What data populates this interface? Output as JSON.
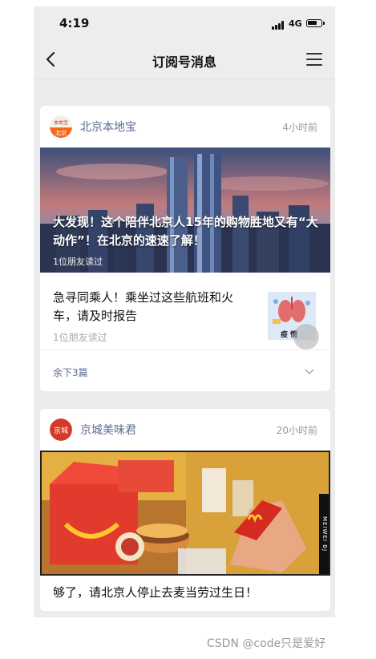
{
  "status": {
    "time": "4:19",
    "network": "4G"
  },
  "nav": {
    "title": "订阅号消息"
  },
  "card1": {
    "source_name": "北京本地宝",
    "time": "4小时前",
    "avatar_text_top": "本地宝",
    "avatar_text_bottom": "北京",
    "hero_title": "大发现！这个陪伴北京人15年的购物胜地又有“大动作”！在北京的速速了解！",
    "hero_read": "1位朋友读过",
    "sub_title": "急寻同乘人！乘坐过这些航班和火车，请及时报告",
    "sub_read": "1位朋友读过",
    "thumb_label": "疫 情",
    "more_label": "余下3篇"
  },
  "card2": {
    "source_name": "京城美味君",
    "avatar_text": "京城",
    "time": "20小时前",
    "photo_tag": "MEIWEI BJ",
    "title": "够了，请北京人停止去麦当劳过生日！"
  },
  "watermark": "CSDN @code只是爱好",
  "colors": {
    "source_name": "#5b6b93",
    "accent_red": "#e53a2a",
    "mcd_yellow": "#ffc72c"
  }
}
